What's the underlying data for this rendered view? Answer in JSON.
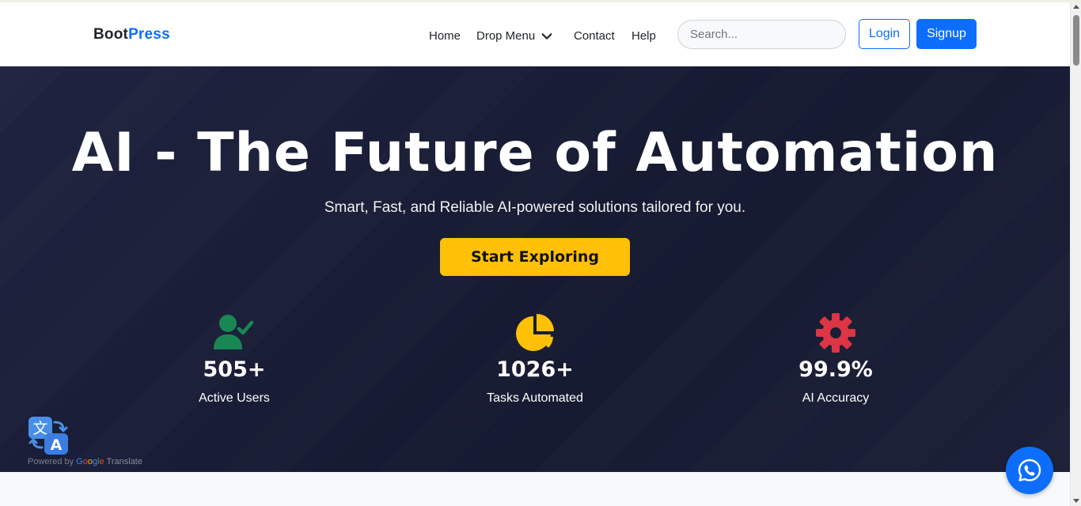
{
  "brand": {
    "part1": "Boot",
    "part2": "Press"
  },
  "nav": {
    "home": "Home",
    "drop_menu": "Drop Menu",
    "contact": "Contact",
    "help": "Help"
  },
  "search": {
    "placeholder": "Search...",
    "value": ""
  },
  "auth": {
    "login": "Login",
    "signup": "Signup"
  },
  "hero": {
    "title": "AI - The Future of Automation",
    "subtitle": "Smart, Fast, and Reliable AI-powered solutions tailored for you.",
    "cta": "Start Exploring"
  },
  "stats": [
    {
      "icon": "user-check-icon",
      "value": "505+",
      "label": "Active Users",
      "color": "#198754"
    },
    {
      "icon": "pie-chart-icon",
      "value": "1026+",
      "label": "Tasks Automated",
      "color": "#ffc107"
    },
    {
      "icon": "gear-icon",
      "value": "99.9%",
      "label": "AI Accuracy",
      "color": "#dc3545"
    }
  ],
  "translate": {
    "powered_by": "Powered by",
    "google": {
      "g": "G",
      "o1": "o",
      "o2": "o",
      "g2": "g",
      "l": "l",
      "e": "e"
    },
    "translate": "Translate"
  },
  "colors": {
    "primary": "#0d6efd",
    "hero_bg": "#1a1e36",
    "cta": "#ffc107",
    "success": "#198754",
    "danger": "#dc3545"
  }
}
